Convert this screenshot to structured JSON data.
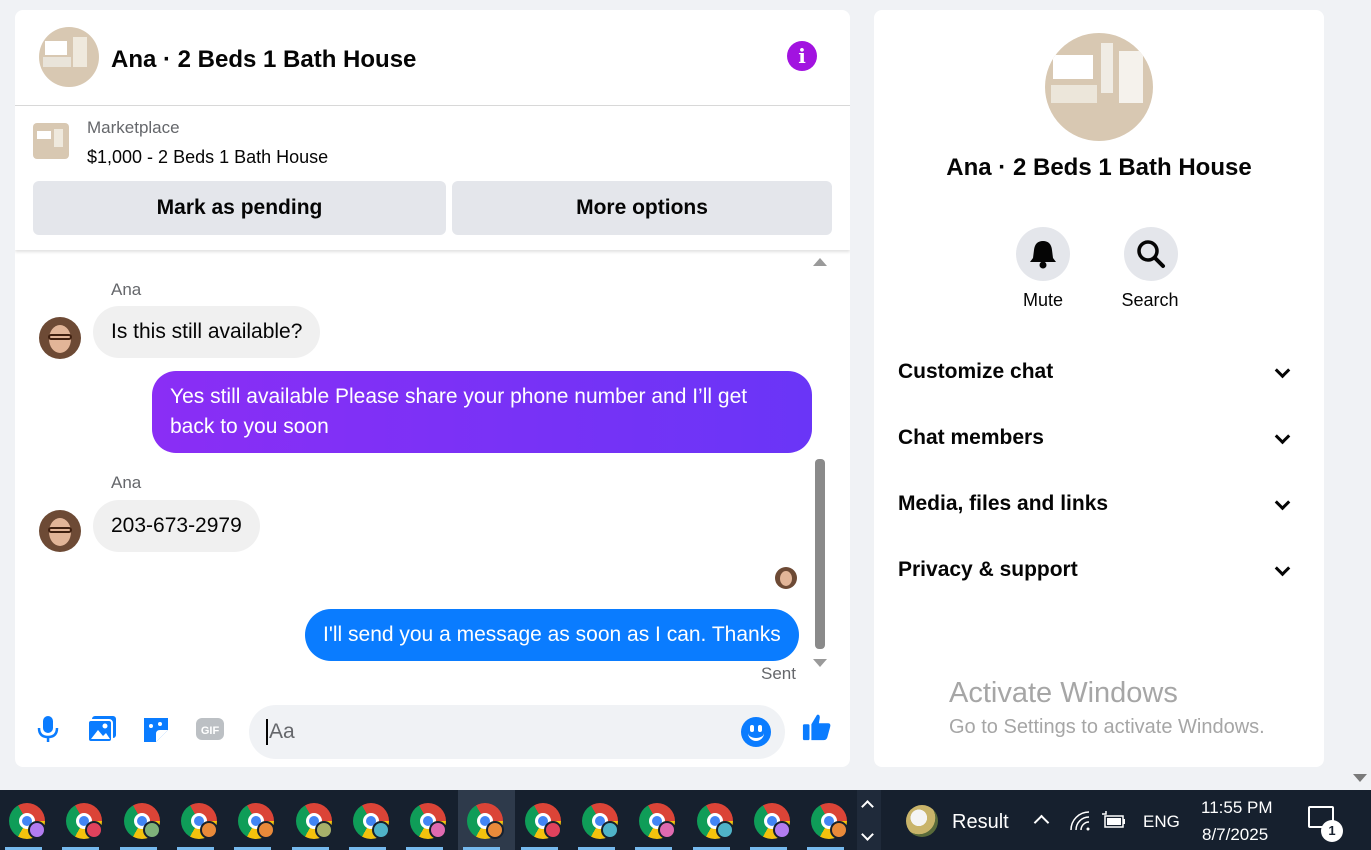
{
  "chat": {
    "title": "Ana · 2 Beds 1 Bath House",
    "info_icon": "info-icon",
    "marketplace": {
      "label": "Marketplace",
      "item": "$1,000 - 2 Beds 1 Bath House",
      "mark_pending": "Mark as pending",
      "more_options": "More options"
    },
    "messages": [
      {
        "sender": "Ana",
        "text": "Is this still available?",
        "direction": "in"
      },
      {
        "text": "Yes still available Please share your phone number and I’ll get back to you soon",
        "direction": "out"
      },
      {
        "sender": "Ana",
        "text": "203-673-2979",
        "direction": "in"
      },
      {
        "text": "I'll send you a message as soon as I can. Thanks",
        "direction": "out"
      }
    ],
    "status": "Sent",
    "composer": {
      "placeholder": "Aa",
      "icons": [
        "microphone-icon",
        "photo-icon",
        "sticker-icon",
        "gif-icon",
        "emoji-icon",
        "thumbs-up-icon"
      ]
    },
    "colors": {
      "purple_bubble": "#7b2ff7",
      "blue_bubble": "#0a7cff",
      "accent": "#a213e0"
    }
  },
  "info": {
    "title": "Ana · 2 Beds 1 Bath House",
    "mute": "Mute",
    "search": "Search",
    "sections": [
      "Customize chat",
      "Chat members",
      "Media, files and links",
      "Privacy & support"
    ]
  },
  "watermark": {
    "line1": "Activate Windows",
    "line2": "Go to Settings to activate Windows."
  },
  "taskbar": {
    "app_count": 15,
    "active_index": 8,
    "badge_colors": [
      "#b27cf0",
      "#e0425d",
      "#7fb27a",
      "#e98a3a",
      "#e98a3a",
      "#a7b06a",
      "#4fb3c8",
      "#e06ab0",
      "#e98a3a",
      "#e0425d",
      "#4fb3c8",
      "#e06ab0",
      "#4fb3c8",
      "#b27cf0",
      "#e98a3a"
    ],
    "tray": {
      "widget": "Result",
      "language": "ENG",
      "time": "11:55 PM",
      "date": "8/7/2025",
      "notifications": "1"
    }
  }
}
